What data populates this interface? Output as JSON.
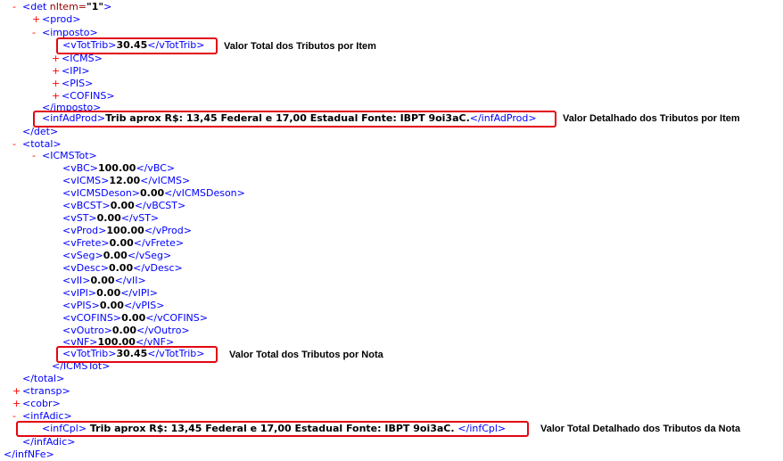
{
  "xml": {
    "rows": [
      {
        "toggle": "-",
        "open": "<det",
        "attr": " nItem=",
        "attr_val": "\"1\"",
        "close": ">"
      },
      {
        "toggle": "+",
        "open": "<prod>"
      },
      {
        "toggle": "-",
        "open": "<imposto>"
      },
      {
        "open": "<vTotTrib>",
        "value": "30.45",
        "close": "</vTotTrib>"
      },
      {
        "toggle": "+",
        "open": "<ICMS>"
      },
      {
        "toggle": "+",
        "open": "<IPI>"
      },
      {
        "toggle": "+",
        "open": "<PIS>"
      },
      {
        "toggle": "+",
        "open": "<COFINS>"
      },
      {
        "close": "</imposto>"
      },
      {
        "open": "<infAdProd>",
        "value": "Trib aprox R$: 13,45 Federal e 17,00 Estadual Fonte: IBPT 9oi3aC.",
        "close": "</infAdProd>"
      },
      {
        "close": "</det>"
      },
      {
        "toggle": "-",
        "open": "<total>"
      },
      {
        "toggle": "-",
        "open": "<ICMSTot>"
      },
      {
        "open": "<vBC>",
        "value": "100.00",
        "close": "</vBC>"
      },
      {
        "open": "<vICMS>",
        "value": "12.00",
        "close": "</vICMS>"
      },
      {
        "open": "<vICMSDeson>",
        "value": "0.00",
        "close": "</vICMSDeson>"
      },
      {
        "open": "<vBCST>",
        "value": "0.00",
        "close": "</vBCST>"
      },
      {
        "open": "<vST>",
        "value": "0.00",
        "close": "</vST>"
      },
      {
        "open": "<vProd>",
        "value": "100.00",
        "close": "</vProd>"
      },
      {
        "open": "<vFrete>",
        "value": "0.00",
        "close": "</vFrete>"
      },
      {
        "open": "<vSeg>",
        "value": "0.00",
        "close": "</vSeg>"
      },
      {
        "open": "<vDesc>",
        "value": "0.00",
        "close": "</vDesc>"
      },
      {
        "open": "<vII>",
        "value": "0.00",
        "close": "</vII>"
      },
      {
        "open": "<vIPI>",
        "value": "0.00",
        "close": "</vIPI>"
      },
      {
        "open": "<vPIS>",
        "value": "0.00",
        "close": "</vPIS>"
      },
      {
        "open": "<vCOFINS>",
        "value": "0.00",
        "close": "</vCOFINS>"
      },
      {
        "open": "<vOutro>",
        "value": "0.00",
        "close": "</vOutro>"
      },
      {
        "open": "<vNF>",
        "value": "100.00",
        "close": "</vNF>"
      },
      {
        "open": "<vTotTrib>",
        "value": "30.45",
        "close": "</vTotTrib>"
      },
      {
        "close": "</ICMSTot>"
      },
      {
        "close": "</total>"
      },
      {
        "toggle": "+",
        "open": "<transp>"
      },
      {
        "toggle": "+",
        "open": "<cobr>"
      },
      {
        "toggle": "-",
        "open": "<infAdic>"
      },
      {
        "open": "<infCpl>",
        "value": " Trib aprox R$: 13,45 Federal e 17,00 Estadual Fonte: IBPT 9oi3aC. ",
        "close": "</infCpl>"
      },
      {
        "close": "</infAdic>"
      },
      {
        "close": "</infNFe>"
      }
    ]
  },
  "annotations": {
    "item_total": "Valor Total dos Tributos por Item",
    "item_detail": "Valor Detalhado dos Tributos por Item",
    "note_total": "Valor Total dos Tributos por Nota",
    "note_detail": "Valor Total Detalhado dos Tributos da Nota"
  },
  "colors": {
    "tag": "#0000ff",
    "toggle": "#ff0000",
    "attribute": "#990000",
    "value": "#000000",
    "highlight_box": "#e30613"
  }
}
